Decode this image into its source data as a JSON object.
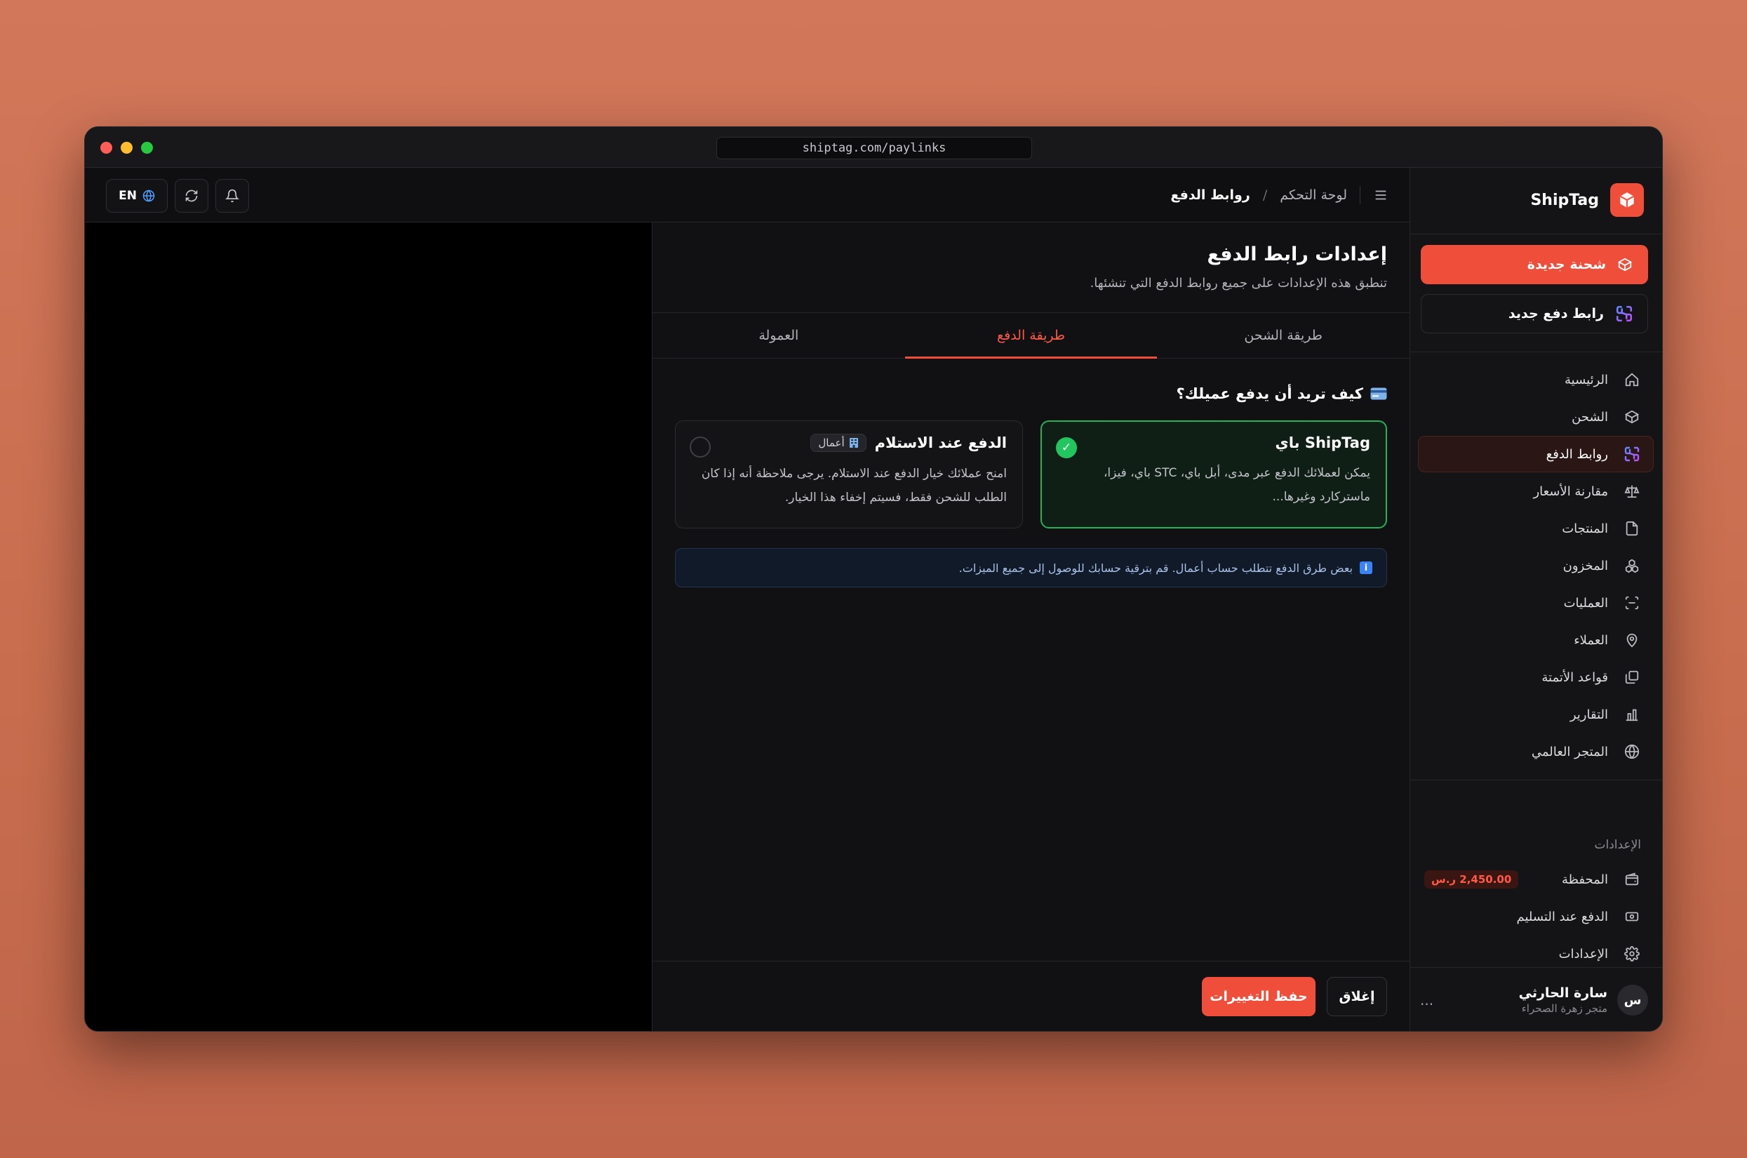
{
  "browser": {
    "url": "shiptag.com/paylinks"
  },
  "brand": {
    "name": "ShipTag"
  },
  "sidebar": {
    "new_shipment": "شحنة جديدة",
    "new_paylink": "رابط دفع جديد",
    "items": [
      {
        "label": "الرئيسية",
        "icon": "home-icon"
      },
      {
        "label": "الشحن",
        "icon": "box-icon"
      },
      {
        "label": "روابط الدفع",
        "icon": "link-icon"
      },
      {
        "label": "مقارنة الأسعار",
        "icon": "scale-icon"
      },
      {
        "label": "المنتجات",
        "icon": "file-icon"
      },
      {
        "label": "المخزون",
        "icon": "boxes-icon"
      },
      {
        "label": "العمليات",
        "icon": "scan-icon"
      },
      {
        "label": "العملاء",
        "icon": "location-icon"
      },
      {
        "label": "قواعد الأتمتة",
        "icon": "copy-icon"
      },
      {
        "label": "التقارير",
        "icon": "bar-chart-icon"
      },
      {
        "label": "المتجر العالمي",
        "icon": "globe-icon"
      }
    ],
    "settings_label": "الإعدادات",
    "settings_items": [
      {
        "label": "المحفظة",
        "badge": "2,450.00 ر.س",
        "icon": "wallet-icon"
      },
      {
        "label": "الدفع عند التسليم",
        "icon": "cash-icon"
      },
      {
        "label": "الإعدادات",
        "icon": "gear-icon"
      }
    ],
    "user": {
      "initial": "س",
      "name": "سارة الحارثي",
      "store": "متجر زهرة الصحراء",
      "more": "..."
    }
  },
  "header": {
    "crumb_parent": "لوحة التحكم",
    "crumb_sep": "/",
    "crumb_current": "روابط الدفع",
    "lang": "EN"
  },
  "panel": {
    "title": "إعدادات رابط الدفع",
    "subtitle": "تنطبق هذه الإعدادات على جميع روابط الدفع التي تنشئها.",
    "tabs": [
      "طريقة الشحن",
      "طريقة الدفع",
      "العمولة"
    ],
    "question": "كيف تريد أن يدفع عميلك؟",
    "option_pay": {
      "title": "ShipTag باي",
      "desc": "يمكن لعملائك الدفع عبر مدى، أبل باي، STC باي، فيزا، ماستركارد وغيرها..."
    },
    "option_cod": {
      "title": "الدفع عند الاستلام",
      "badge": "أعمال",
      "desc": "امنح عملائك خيار الدفع عند الاستلام. يرجى ملاحظة أنه إذا كان الطلب للشحن فقط، فسيتم إخفاء هذا الخيار."
    },
    "info": "بعض طرق الدفع تتطلب حساب أعمال. قم بترقية حسابك للوصول إلى جميع الميزات.",
    "close": "إغلاق",
    "save": "حفظ التغييرات"
  },
  "colors": {
    "accent": "#ef4f3a",
    "success": "#22c55e",
    "info": "#3b82f6"
  }
}
